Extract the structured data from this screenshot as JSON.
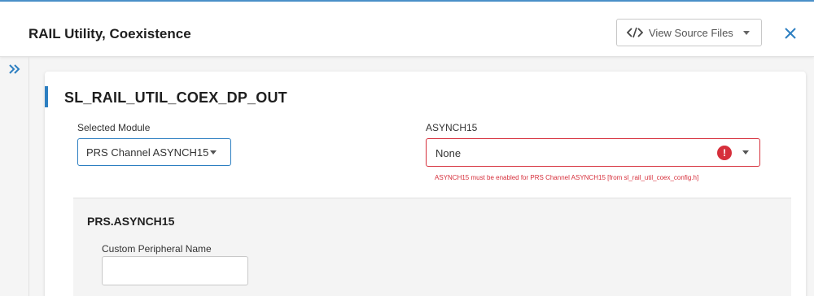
{
  "header": {
    "title": "RAIL Utility, Coexistence",
    "view_source_label": "View Source Files"
  },
  "card": {
    "title": "SL_RAIL_UTIL_COEX_DP_OUT",
    "selected_module": {
      "label": "Selected Module",
      "value": "PRS Channel ASYNCH15"
    },
    "asynch": {
      "label": "ASYNCH15",
      "value": "None",
      "error_icon_text": "!",
      "error_message": "ASYNCH15 must be enabled for PRS Channel ASYNCH15 [from sl_rail_util_coex_config.h]"
    },
    "sub_panel": {
      "title": "PRS.ASYNCH15",
      "custom_name_label": "Custom Peripheral Name",
      "custom_name_value": ""
    }
  },
  "colors": {
    "accent": "#2d7fc1",
    "error": "#d62f3b",
    "top_line": "#4a90c9"
  },
  "icons": [
    "code-icon",
    "chevron-down-icon",
    "close-icon",
    "double-chevron-right-icon",
    "error-icon"
  ]
}
